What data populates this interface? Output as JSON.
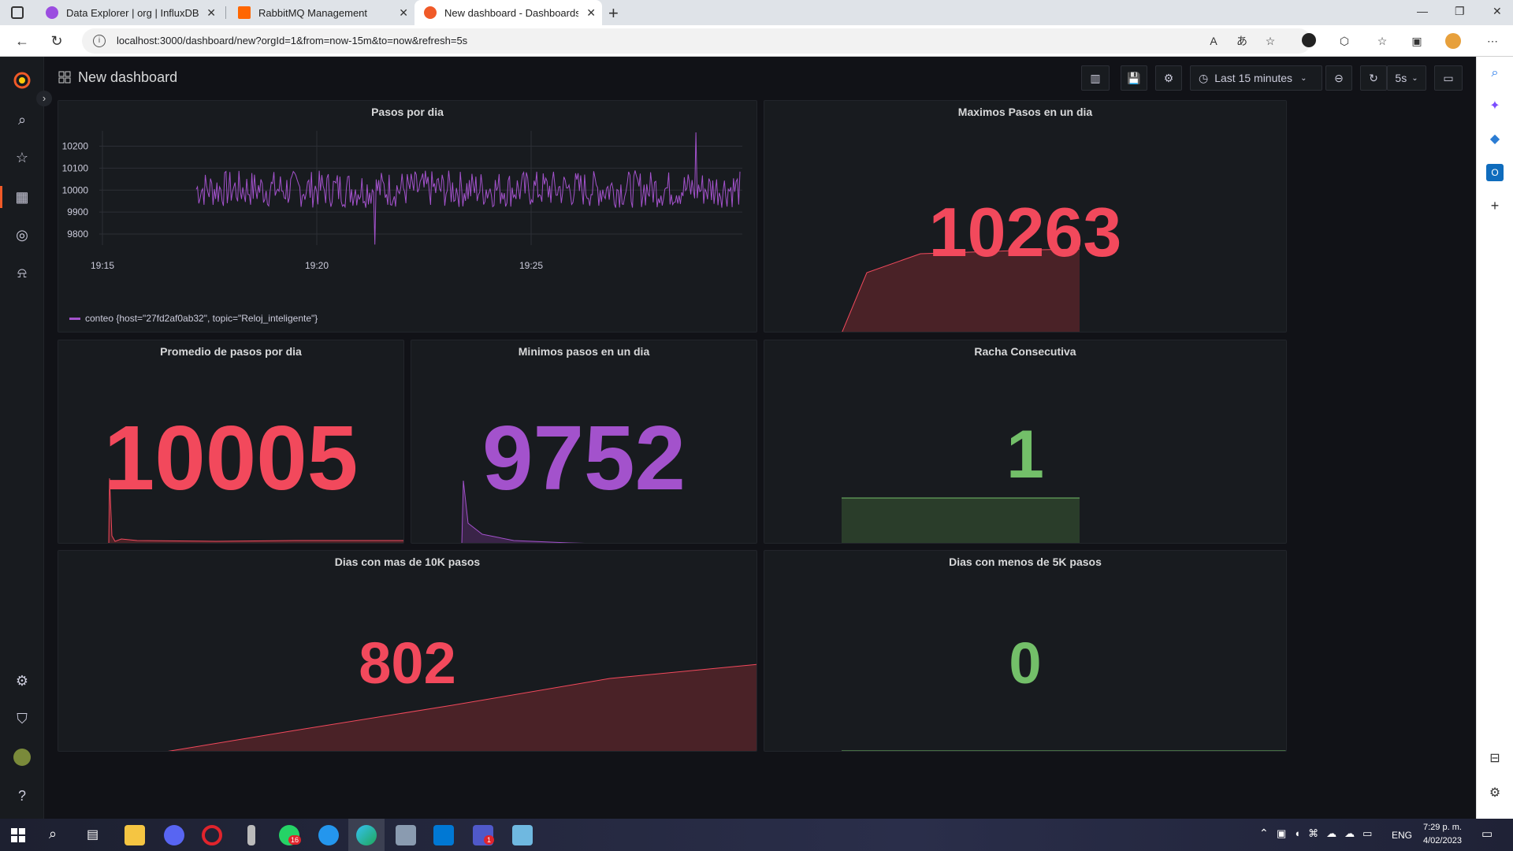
{
  "browser": {
    "tabs": [
      {
        "label": "Data Explorer | org | InfluxDB",
        "color": "#9b4de0"
      },
      {
        "label": "RabbitMQ Management",
        "color": "#ff6600"
      },
      {
        "label": "New dashboard - Dashboards - G",
        "color": "#f05a28"
      }
    ],
    "url": "localhost:3000/dashboard/new?orgId=1&from=now-15m&to=now&refresh=5s"
  },
  "dashboard": {
    "title": "New dashboard",
    "time_range": "Last 15 minutes",
    "refresh": "5s"
  },
  "panels": {
    "pasos_por_dia": {
      "title": "Pasos por dia",
      "legend": "conteo {host=\"27fd2af0ab32\", topic=\"Reloj_inteligente\"}"
    },
    "maximos": {
      "title": "Maximos Pasos en un dia",
      "value": "10263",
      "color": "#f2495c"
    },
    "promedio": {
      "title": "Promedio de pasos por dia",
      "value": "10005",
      "color": "#f2495c"
    },
    "minimos": {
      "title": "Minimos pasos en un dia",
      "value": "9752",
      "color": "#a352cc"
    },
    "racha": {
      "title": "Racha Consecutiva",
      "value": "1",
      "color": "#73bf69"
    },
    "mas10k": {
      "title": "Dias con mas de 10K pasos",
      "value": "802",
      "color": "#f2495c"
    },
    "menos5k": {
      "title": "Dias con menos de 5K pasos",
      "value": "0",
      "color": "#73bf69"
    }
  },
  "chart_data": {
    "type": "line",
    "x_ticks": [
      "19:15",
      "19:20",
      "19:25"
    ],
    "y_ticks": [
      "10200",
      "10100",
      "10000",
      "9900",
      "9800"
    ],
    "ylim": [
      9750,
      10270
    ],
    "series": [
      {
        "name": "conteo {host=\"27fd2af0ab32\", topic=\"Reloj_inteligente\"}",
        "color": "#a352cc",
        "mean": 10005,
        "min": 9752,
        "max": 10263
      }
    ]
  },
  "taskbar": {
    "lang": "ENG",
    "time": "7:29 p. m.",
    "date": "4/02/2023",
    "badges": {
      "whatsapp": "16",
      "teams": "1"
    }
  }
}
